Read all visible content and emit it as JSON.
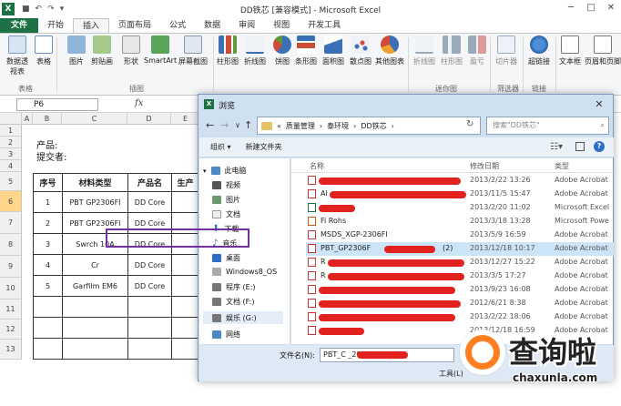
{
  "app": {
    "title": "DD铁芯 [兼容模式] - Microsoft Excel",
    "logo": "X"
  },
  "ribbon_tabs": [
    "文件",
    "开始",
    "插入",
    "页面布局",
    "公式",
    "数据",
    "审阅",
    "视图",
    "开发工具"
  ],
  "ribbon": {
    "buttons": [
      "数据透视表",
      "表格",
      "图片",
      "剪贴画",
      "形状",
      "SmartArt",
      "屏幕截图",
      "柱形图",
      "折线图",
      "饼图",
      "条形图",
      "面积图",
      "散点图",
      "其他图表",
      "折线图",
      "柱形图",
      "盈亏",
      "切片器",
      "超链接",
      "文本框",
      "页眉和页脚"
    ],
    "groups": [
      "表格",
      "插图",
      "迷你图",
      "筛选器",
      "链接"
    ]
  },
  "formula_bar": {
    "name_box": "P6",
    "fx": "fx"
  },
  "sheet": {
    "columns": [
      "A",
      "B",
      "C",
      "D",
      "E"
    ],
    "rows": [
      "1",
      "2",
      "3",
      "4",
      "5",
      "6",
      "7",
      "8",
      "9",
      "10",
      "11",
      "12",
      "13"
    ],
    "product_label": "产品:",
    "submitter_label": "提交者:",
    "table_headers": [
      "序号",
      "材料类型",
      "产品名",
      "生产"
    ],
    "table_rows": [
      [
        "1",
        "PBT GP2306FI",
        "DD Core",
        ""
      ],
      [
        "2",
        "PBT GP2306FI",
        "DD Core",
        ""
      ],
      [
        "3",
        "Swrch 10A",
        "DD Core",
        ""
      ],
      [
        "4",
        "Cr",
        "DD Core",
        ""
      ],
      [
        "5",
        "Garfilm EM6",
        "DD Core",
        ""
      ]
    ]
  },
  "dialog": {
    "title": "浏览",
    "breadcrumb": [
      "质量管理",
      "泰环境",
      "DD铁芯"
    ],
    "search_placeholder": "搜索\"DD铁芯\"",
    "organize": "组织 ▾",
    "new_folder": "新建文件夹",
    "nav_items": [
      "此电脑",
      "视频",
      "图片",
      "文档",
      "下载",
      "音乐",
      "桌面",
      "Windows8_OS",
      "程序 (E:)",
      "文档 (F:)",
      "娱乐 (G:)",
      "网络"
    ],
    "columns": [
      "名称",
      "修改日期",
      "类型"
    ],
    "files": [
      {
        "name": "",
        "date": "2013/2/22 13:26",
        "type": "Adobe Acrobat"
      },
      {
        "name": "Al",
        "date": "2013/11/5 15:47",
        "type": "Adobe Acrobat"
      },
      {
        "name": "",
        "date": "2013/2/20 11:02",
        "type": "Microsoft Excel"
      },
      {
        "name": "Fi  Rohs",
        "date": "2013/3/18 13:28",
        "type": "Microsoft Powe"
      },
      {
        "name": "MSDS_XGP-2306FI",
        "date": "2013/5/9 16:59",
        "type": "Adobe Acrobat"
      },
      {
        "name": "PBT_GP2306F",
        "date": "2013/12/18 10:17",
        "type": "Adobe Acrobat"
      },
      {
        "name": "R",
        "date": "2013/12/27 15:22",
        "type": "Adobe Acrobat"
      },
      {
        "name": "R",
        "date": "2013/3/5 17:27",
        "type": "Adobe Acrobat"
      },
      {
        "name": "",
        "date": "2013/9/23 16:08",
        "type": "Adobe Acrobat"
      },
      {
        "name": "",
        "date": "2012/6/21 8:38",
        "type": "Adobe Acrobat"
      },
      {
        "name": "",
        "date": "2013/2/22 18:06",
        "type": "Adobe Acrobat"
      },
      {
        "name": "",
        "date": "2013/12/18 16:59",
        "type": "Adobe Acrobat"
      }
    ],
    "selected_suffix": "(2)",
    "filename_label": "文件名(N):",
    "filename_value": "PBT_C                _20131113_(2)",
    "tools": "工具(L)"
  },
  "watermark": {
    "text": "查询啦",
    "url": "chaxunla.com"
  },
  "colors": {
    "excel_green": "#1e7145",
    "selection": "#cce4f7",
    "highlight_box": "#7030a0",
    "redaction": "#e2221f",
    "watermark_orange": "#ff7e1f"
  }
}
